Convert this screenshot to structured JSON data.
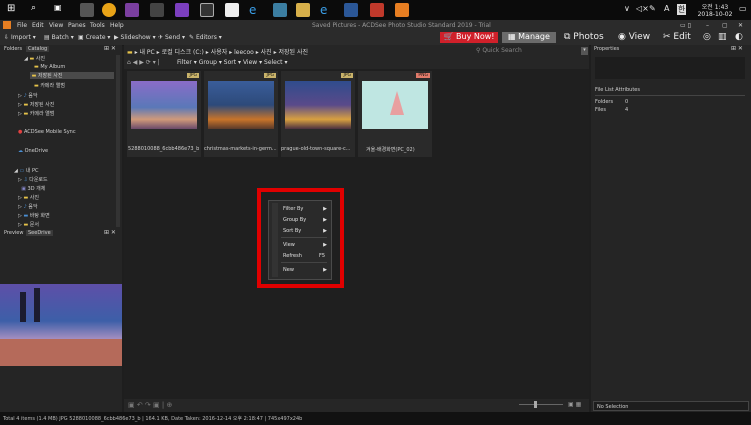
{
  "title": "Saved Pictures - ACDSee Photo Studio Standard 2019 - Trial",
  "taskbar": {
    "time": "오전 1:43",
    "date": "2018-10-02",
    "lang": "A",
    "ime": "한"
  },
  "menu": [
    "File",
    "Edit",
    "View",
    "Panes",
    "Tools",
    "Help"
  ],
  "toolbar": {
    "import": "Import",
    "batch": "Batch",
    "create": "Create",
    "slideshow": "Slideshow",
    "send": "Send",
    "editors": "Editors",
    "buy": "Buy Now!",
    "manage": "Manage",
    "photos": "Photos",
    "view": "View",
    "edit": "Edit"
  },
  "folders": {
    "tab1": "Folders",
    "tab2": "Catalog",
    "items": [
      "사진",
      "My Album",
      "저장된 사진",
      "카메라 앨범",
      "음악",
      "저장된 사진",
      "카메라 앨범",
      "ACDSee Mobile Sync",
      "OneDrive",
      "내 PC",
      "다운로드",
      "3D 개체",
      "사진",
      "음악",
      "바탕 화면",
      "문서"
    ]
  },
  "preview": {
    "tab1": "Preview",
    "tab2": "SeeDrive"
  },
  "breadcrumb": [
    "내 PC",
    "로컬 디스크 (C:)",
    "사용자",
    "leecoo",
    "사진",
    "저장된 사진"
  ],
  "quick_search": "Quick Search",
  "filterbar": [
    "Filter",
    "Group",
    "Sort",
    "View",
    "Select"
  ],
  "thumbnails": [
    {
      "name": "5288010088_6cbb486e73_b",
      "badge": "JPG",
      "color": "#8a6cc8"
    },
    {
      "name": "christmas-markets-in-germ...",
      "badge": "JPG",
      "color": "#3a5d9a"
    },
    {
      "name": "prague-old-town-square-c...",
      "badge": "JPG",
      "color": "#2f4c8c"
    },
    {
      "name": "겨울-배경화면(PC_02)",
      "badge": "PNG",
      "color": "#bfe6e2"
    }
  ],
  "context_menu": {
    "filter": "Filter By",
    "group": "Group By",
    "sort": "Sort By",
    "view": "View",
    "refresh": "Refresh",
    "refresh_key": "F5",
    "new": "New"
  },
  "props": {
    "title": "Properties",
    "attrs": "File List Attributes",
    "folders": "Folders",
    "folders_v": "0",
    "files": "Files",
    "files_v": "4",
    "no_sel": "No Selection"
  },
  "status": "Total 4 items (1.4 MB)   JPG  5288010088_6cbb486e73_b | 164.1 KB, Date Taken: 2016-12-14 오후 2:18:47 | 745x497x24b"
}
